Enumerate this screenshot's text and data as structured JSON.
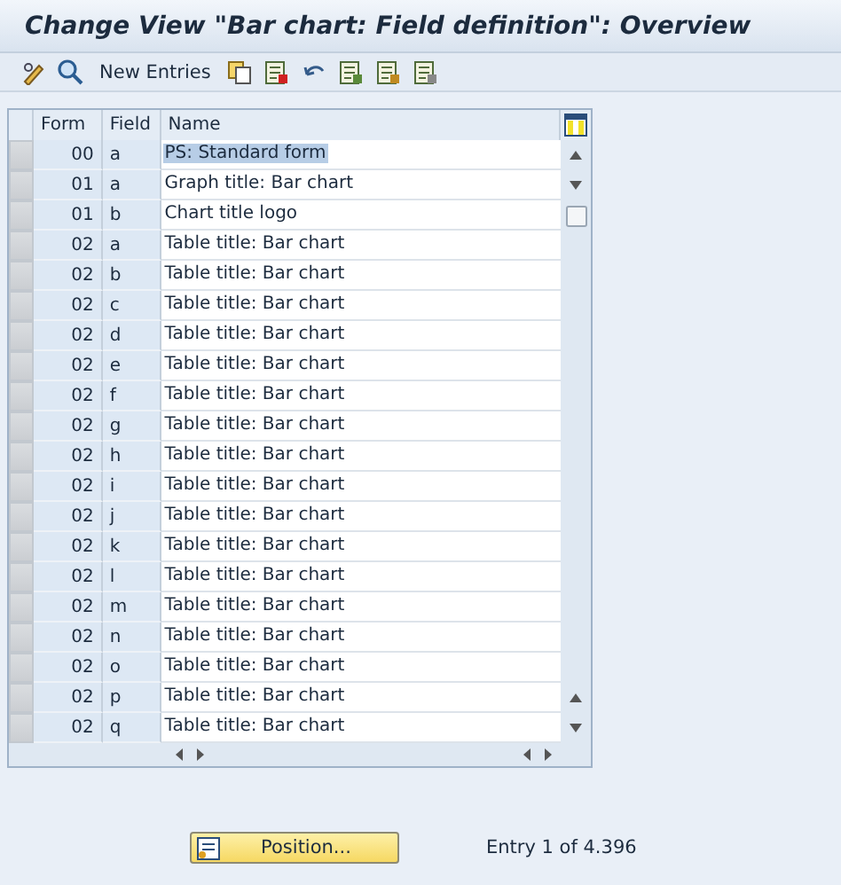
{
  "window": {
    "title": "Change View \"Bar chart: Field definition\": Overview"
  },
  "toolbar": {
    "new_entries": "New Entries"
  },
  "table": {
    "columns": [
      "Form",
      "Field",
      "Name"
    ],
    "rows": [
      {
        "form": "00",
        "field": "a",
        "name": "PS: Standard form",
        "highlighted": true
      },
      {
        "form": "01",
        "field": "a",
        "name": "Graph title: Bar chart",
        "highlighted": false
      },
      {
        "form": "01",
        "field": "b",
        "name": "Chart title logo",
        "highlighted": false
      },
      {
        "form": "02",
        "field": "a",
        "name": "Table title: Bar chart",
        "highlighted": false
      },
      {
        "form": "02",
        "field": "b",
        "name": "Table title: Bar chart",
        "highlighted": false
      },
      {
        "form": "02",
        "field": "c",
        "name": "Table title: Bar chart",
        "highlighted": false
      },
      {
        "form": "02",
        "field": "d",
        "name": "Table title: Bar chart",
        "highlighted": false
      },
      {
        "form": "02",
        "field": "e",
        "name": "Table title: Bar chart",
        "highlighted": false
      },
      {
        "form": "02",
        "field": "f",
        "name": "Table title: Bar chart",
        "highlighted": false
      },
      {
        "form": "02",
        "field": "g",
        "name": "Table title: Bar chart",
        "highlighted": false
      },
      {
        "form": "02",
        "field": "h",
        "name": "Table title: Bar chart",
        "highlighted": false
      },
      {
        "form": "02",
        "field": "i",
        "name": "Table title: Bar chart",
        "highlighted": false
      },
      {
        "form": "02",
        "field": "j",
        "name": "Table title: Bar chart",
        "highlighted": false
      },
      {
        "form": "02",
        "field": "k",
        "name": "Table title: Bar chart",
        "highlighted": false
      },
      {
        "form": "02",
        "field": "l",
        "name": "Table title: Bar chart",
        "highlighted": false
      },
      {
        "form": "02",
        "field": "m",
        "name": "Table title: Bar chart",
        "highlighted": false
      },
      {
        "form": "02",
        "field": "n",
        "name": "Table title: Bar chart",
        "highlighted": false
      },
      {
        "form": "02",
        "field": "o",
        "name": "Table title: Bar chart",
        "highlighted": false
      },
      {
        "form": "02",
        "field": "p",
        "name": "Table title: Bar chart",
        "highlighted": false
      },
      {
        "form": "02",
        "field": "q",
        "name": "Table title: Bar chart",
        "highlighted": false
      }
    ]
  },
  "footer": {
    "position_button": "Position...",
    "entry_info": "Entry 1 of 4.396"
  }
}
